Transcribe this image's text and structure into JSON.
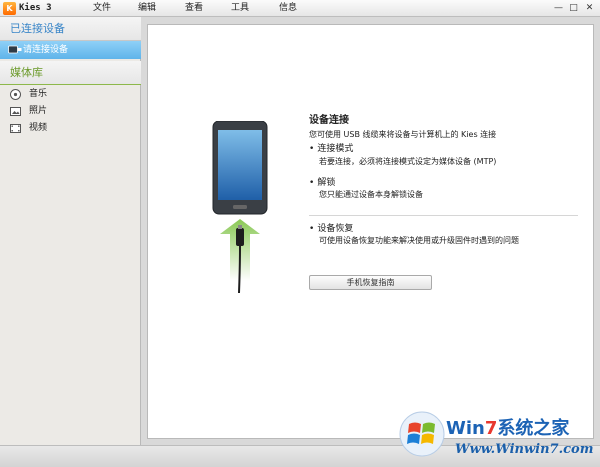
{
  "window": {
    "app_logo_letter": "K",
    "title": "Kies 3",
    "controls": {
      "minimize": "—",
      "maximize": "□",
      "close": "✕"
    }
  },
  "menu": {
    "items": [
      "文件",
      "编辑",
      "查看",
      "工具",
      "信息"
    ]
  },
  "sidebar": {
    "devices_header": "已连接设备",
    "device_item": "请连接设备",
    "library_header": "媒体库",
    "library_items": [
      {
        "label": "音乐",
        "icon": "music-icon"
      },
      {
        "label": "照片",
        "icon": "photo-icon"
      },
      {
        "label": "视频",
        "icon": "video-icon"
      }
    ]
  },
  "main": {
    "title": "设备连接",
    "description": "您可使用 USB 线缆来将设备与计算机上的 Kies 连接",
    "sections": [
      {
        "heading": "连接模式",
        "text": "若要连接，必须将连接模式设定为媒体设备 (MTP)"
      },
      {
        "heading": "解锁",
        "text": "您只能通过设备本身解锁设备"
      },
      {
        "heading": "设备恢复",
        "text": "可使用设备恢复功能来解决使用或升级固件时遇到的问题"
      }
    ],
    "recovery_button": "手机恢复指南"
  },
  "watermark": {
    "brand_prefix": "Win",
    "brand_digit": "7",
    "brand_suffix": "系统之家",
    "url": "Www.Winwin7.com"
  },
  "colors": {
    "accent_blue": "#5fb4ea",
    "devices_header": "#3a86c8",
    "library_header": "#6b9a2a",
    "arrow_green": "#7cc242"
  }
}
